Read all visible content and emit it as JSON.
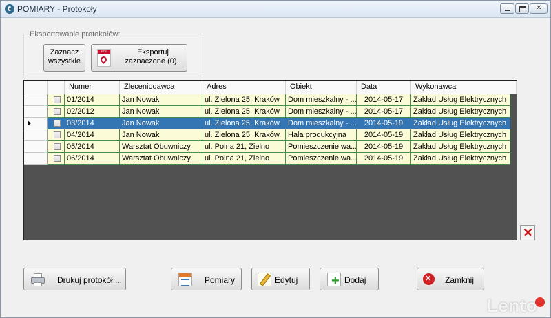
{
  "window": {
    "title": "POMIARY - Protokoły"
  },
  "export_group": {
    "label": "Eksportowanie protokołów:",
    "select_all_line1": "Zaznacz",
    "select_all_line2": "wszystkie",
    "export_line1": "Eksportuj",
    "export_line2": "zaznaczone (0).."
  },
  "grid": {
    "columns": [
      "Numer",
      "Zleceniodawca",
      "Adres",
      "Obiekt",
      "Data",
      "Wykonawca"
    ],
    "rows": [
      {
        "numer": "01/2014",
        "zleceniodawca": "Jan Nowak",
        "adres": "ul. Zielona 25, Kraków",
        "obiekt": "Dom mieszkalny - ...",
        "data": "2014-05-17",
        "wykonawca": "Zakład Usług Elektrycznych"
      },
      {
        "numer": "02/2012",
        "zleceniodawca": "Jan Nowak",
        "adres": "ul. Zielona 25, Kraków",
        "obiekt": "Dom mieszkalny - ...",
        "data": "2014-05-17",
        "wykonawca": "Zakład Usług Elektrycznych"
      },
      {
        "numer": "03/2014",
        "zleceniodawca": "Jan Nowak",
        "adres": "ul. Zielona 25, Kraków",
        "obiekt": "Dom mieszkalny - ...",
        "data": "2014-05-19",
        "wykonawca": "Zakład Usług Elektrycznych"
      },
      {
        "numer": "04/2014",
        "zleceniodawca": "Jan Nowak",
        "adres": "ul. Zielona 25, Kraków",
        "obiekt": "Hala produkcyjna",
        "data": "2014-05-19",
        "wykonawca": "Zakład Usług Elektrycznych"
      },
      {
        "numer": "05/2014",
        "zleceniodawca": "Warsztat Obuwniczy",
        "adres": "ul. Polna 21, Zielno",
        "obiekt": "Pomieszczenie wa...",
        "data": "2014-05-19",
        "wykonawca": "Zakład Usług Elektrycznych"
      },
      {
        "numer": "06/2014",
        "zleceniodawca": "Warsztat Obuwniczy",
        "adres": "ul. Polna 21, Zielno",
        "obiekt": "Pomieszczenie wa...",
        "data": "2014-05-19",
        "wykonawca": "Zakład Usług Elektrycznych"
      }
    ],
    "selected_row": 2
  },
  "buttons": {
    "print": "Drukuj protokół ...",
    "measurements": "Pomiary",
    "edit": "Edytuj",
    "add": "Dodaj",
    "close": "Zamknij"
  },
  "watermark": "Lento",
  "colors": {
    "row_background": "#fbfbd7",
    "row_border": "#4a8a4a",
    "selected_row": "#3476b4",
    "grid_background": "#515151",
    "delete_red": "#d01818"
  }
}
